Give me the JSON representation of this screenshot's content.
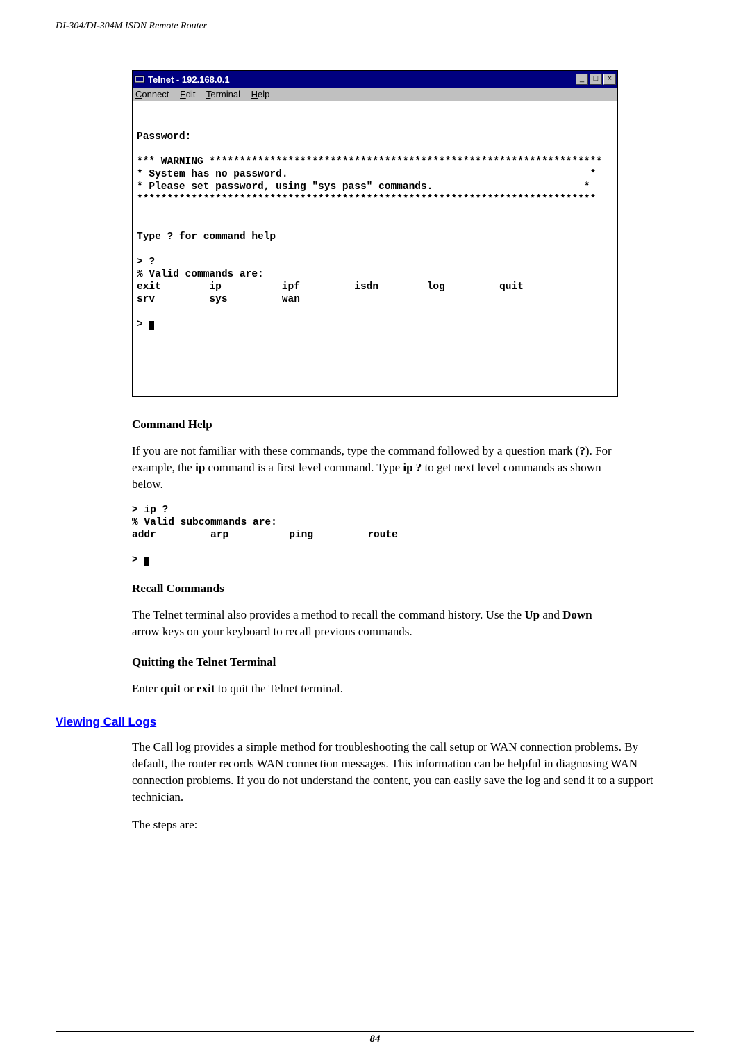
{
  "header": {
    "title": "DI-304/DI-304M ISDN Remote Router"
  },
  "telnet": {
    "title": "Telnet - 192.168.0.1",
    "menu": {
      "connect": "Connect",
      "edit": "Edit",
      "terminal": "Terminal",
      "help": "Help"
    },
    "win_btn_min": "_",
    "win_btn_max": "□",
    "win_btn_close": "×",
    "lines": {
      "blank": "",
      "password": "Password:",
      "warning": "*** WARNING *****************************************************************",
      "syspass": "* System has no password.                                                  *",
      "pleaseset": "* Please set password, using \"sys pass\" commands.                         *",
      "stars": "****************************************************************************",
      "typehelp": "Type ? for command help",
      "prompt_q": "> ?",
      "validcmds": "% Valid commands are:",
      "row1": "exit        ip          ipf         isdn        log         quit",
      "row2": "srv         sys         wan",
      "prompt": "> "
    }
  },
  "sections": {
    "cmdhelp_heading": "Command Help",
    "cmdhelp_para": "If you are not familiar with these commands, type the command followed by a question mark (?). For example, the ip command is a first level command. Type ip ? to get next level commands as shown below.",
    "subcmd": {
      "l1": "> ip ?",
      "l2": "% Valid subcommands are:",
      "l3": "addr         arp          ping         route",
      "l4": "",
      "l5": "> "
    },
    "recall_heading": "Recall Commands",
    "recall_para": "The Telnet terminal also provides a method to recall the command history. Use the Up and Down arrow keys on your keyboard to recall previous commands.",
    "quit_heading": "Quitting the Telnet Terminal",
    "quit_para": "Enter quit or exit to quit the Telnet terminal.",
    "viewlogs_heading": "Viewing Call Logs",
    "viewlogs_para": "The Call log provides a simple method for troubleshooting the call setup or WAN connection problems. By default, the router records WAN connection messages. This information can be helpful in diagnosing WAN connection problems. If you do not understand the content, you can easily save the log and send it to a support technician.",
    "steps_intro": "The steps are:"
  },
  "footer": {
    "page": "84"
  }
}
